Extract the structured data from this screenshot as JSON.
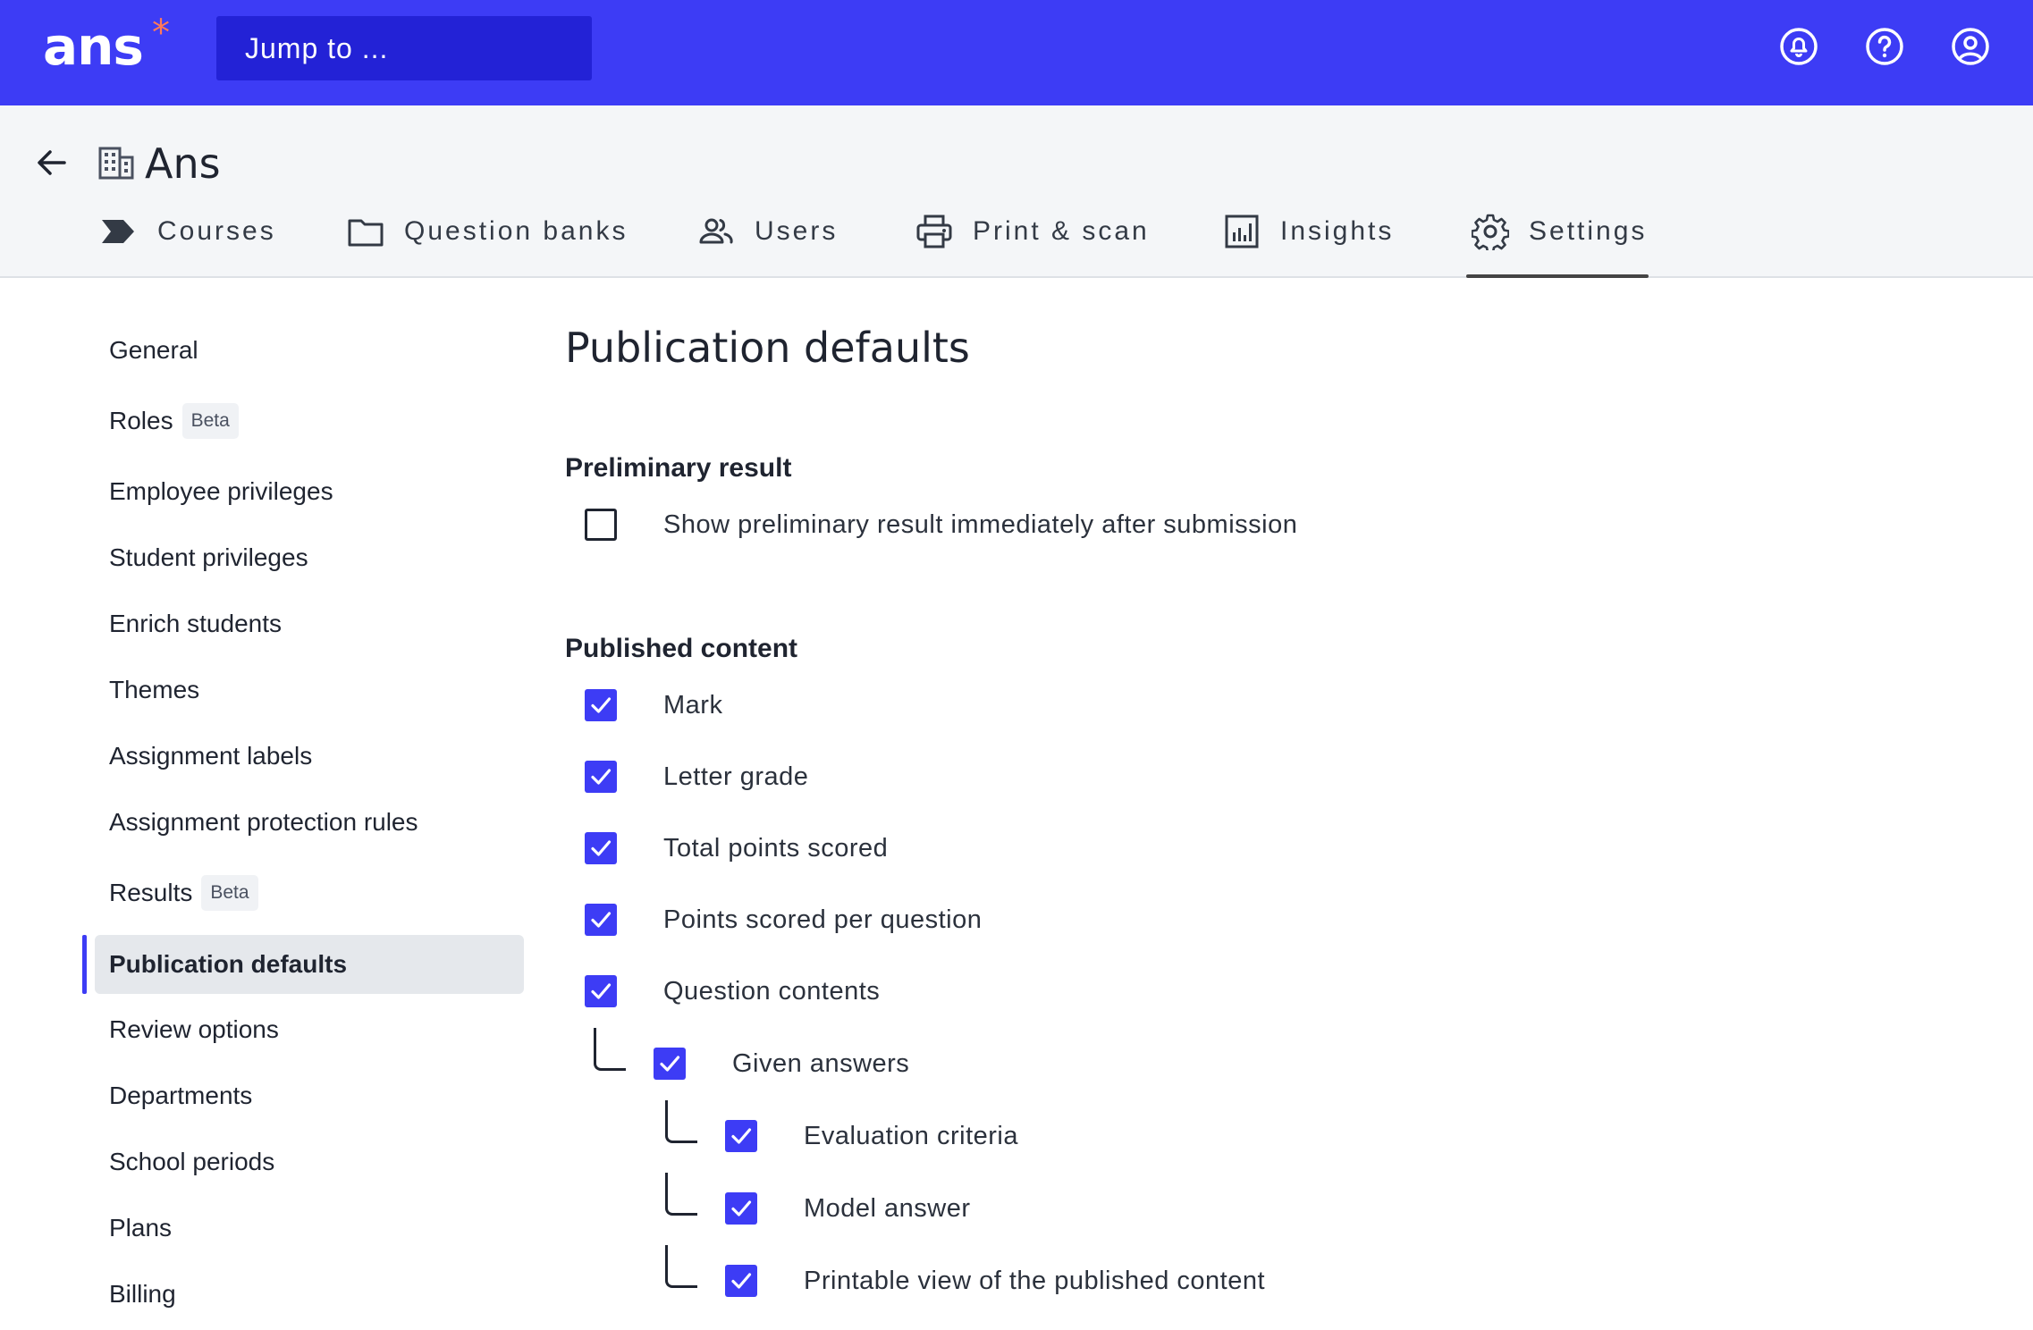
{
  "app": {
    "logo_text": "ans",
    "logo_star": "*",
    "jump_placeholder": "Jump to ...",
    "brand_color": "#3d3cf5",
    "accent_color": "#ff7a59"
  },
  "top_icons": [
    "notifications-icon",
    "help-icon",
    "account-icon"
  ],
  "header": {
    "org_name": "Ans",
    "tabs": [
      {
        "label": "Courses",
        "icon": "courses-icon",
        "active": false
      },
      {
        "label": "Question banks",
        "icon": "folder-icon",
        "active": false
      },
      {
        "label": "Users",
        "icon": "users-icon",
        "active": false
      },
      {
        "label": "Print & scan",
        "icon": "printer-icon",
        "active": false
      },
      {
        "label": "Insights",
        "icon": "insights-icon",
        "active": false
      },
      {
        "label": "Settings",
        "icon": "gear-icon",
        "active": true
      }
    ]
  },
  "sidebar": {
    "items": [
      {
        "label": "General"
      },
      {
        "label": "Roles",
        "badge": "Beta"
      },
      {
        "label": "Employee privileges"
      },
      {
        "label": "Student privileges"
      },
      {
        "label": "Enrich students"
      },
      {
        "label": "Themes"
      },
      {
        "label": "Assignment labels"
      },
      {
        "label": "Assignment protection rules"
      },
      {
        "label": "Results",
        "badge": "Beta"
      },
      {
        "label": "Publication defaults",
        "active": true
      },
      {
        "label": "Review options"
      },
      {
        "label": "Departments"
      },
      {
        "label": "School periods"
      },
      {
        "label": "Plans"
      },
      {
        "label": "Billing"
      }
    ]
  },
  "main": {
    "title": "Publication defaults",
    "preliminary": {
      "heading": "Preliminary result",
      "options": [
        {
          "label": "Show preliminary result immediately after submission",
          "checked": false
        }
      ]
    },
    "published": {
      "heading": "Published content",
      "options": [
        {
          "label": "Mark",
          "checked": true,
          "level": 0
        },
        {
          "label": "Letter grade",
          "checked": true,
          "level": 0
        },
        {
          "label": "Total points scored",
          "checked": true,
          "level": 0
        },
        {
          "label": "Points scored per question",
          "checked": true,
          "level": 0
        },
        {
          "label": "Question contents",
          "checked": true,
          "level": 0
        },
        {
          "label": "Given answers",
          "checked": true,
          "level": 1
        },
        {
          "label": "Evaluation criteria",
          "checked": true,
          "level": 2
        },
        {
          "label": "Model answer",
          "checked": true,
          "level": 2
        },
        {
          "label": "Printable view of the published content",
          "checked": true,
          "level": 2
        }
      ]
    }
  }
}
